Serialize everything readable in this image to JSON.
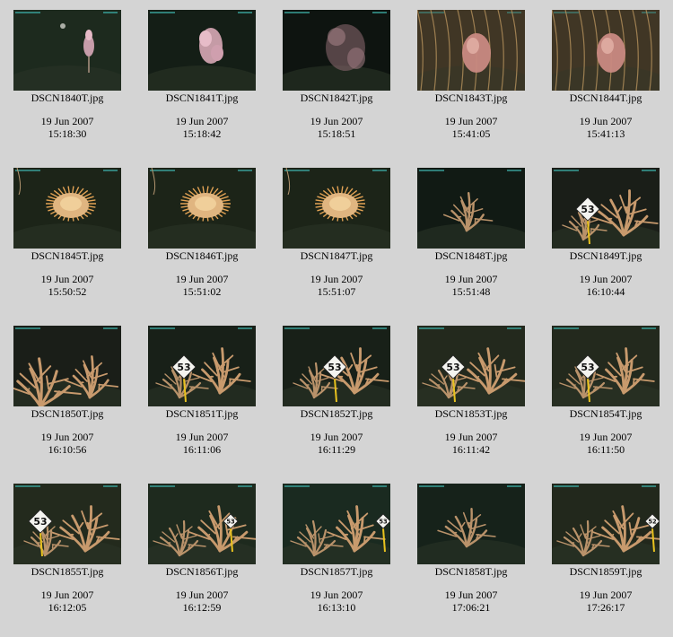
{
  "gallery": {
    "items": [
      {
        "filename": "DSCN1840T.jpg",
        "date": "19 Jun 2007",
        "time": "15:18:30",
        "thumb_icon": "pink-coral-small-photo",
        "bg": "#1d2a1e"
      },
      {
        "filename": "DSCN1841T.jpg",
        "date": "19 Jun 2007",
        "time": "15:18:42",
        "thumb_icon": "pink-coral-photo",
        "bg": "#141e16"
      },
      {
        "filename": "DSCN1842T.jpg",
        "date": "19 Jun 2007",
        "time": "15:18:51",
        "thumb_icon": "pink-coral-dark-photo",
        "bg": "#0e1410"
      },
      {
        "filename": "DSCN1843T.jpg",
        "date": "19 Jun 2007",
        "time": "15:41:05",
        "thumb_icon": "anemone-photo",
        "bg": "#3a3222"
      },
      {
        "filename": "DSCN1844T.jpg",
        "date": "19 Jun 2007",
        "time": "15:41:13",
        "thumb_icon": "anemone-photo",
        "bg": "#3a3222"
      },
      {
        "filename": "DSCN1845T.jpg",
        "date": "19 Jun 2007",
        "time": "15:50:52",
        "thumb_icon": "orange-anemone-photo",
        "bg": "#1c2418"
      },
      {
        "filename": "DSCN1846T.jpg",
        "date": "19 Jun 2007",
        "time": "15:51:02",
        "thumb_icon": "orange-anemone-photo",
        "bg": "#1c2418"
      },
      {
        "filename": "DSCN1847T.jpg",
        "date": "19 Jun 2007",
        "time": "15:51:07",
        "thumb_icon": "orange-anemone-photo",
        "bg": "#1c2418"
      },
      {
        "filename": "DSCN1848T.jpg",
        "date": "19 Jun 2007",
        "time": "15:51:48",
        "thumb_icon": "sea-fan-photo",
        "bg": "#111a14"
      },
      {
        "filename": "DSCN1849T.jpg",
        "date": "19 Jun 2007",
        "time": "16:10:44",
        "thumb_icon": "coral-marker-photo",
        "bg": "#1a1e18",
        "marker": "53"
      },
      {
        "filename": "DSCN1850T.jpg",
        "date": "19 Jun 2007",
        "time": "16:10:56",
        "thumb_icon": "coral-colony-photo",
        "bg": "#1a1e18"
      },
      {
        "filename": "DSCN1851T.jpg",
        "date": "19 Jun 2007",
        "time": "16:11:06",
        "thumb_icon": "coral-marker-photo",
        "bg": "#182018",
        "marker": "53"
      },
      {
        "filename": "DSCN1852T.jpg",
        "date": "19 Jun 2007",
        "time": "16:11:29",
        "thumb_icon": "coral-marker-photo",
        "bg": "#182018",
        "marker": "53"
      },
      {
        "filename": "DSCN1853T.jpg",
        "date": "19 Jun 2007",
        "time": "16:11:42",
        "thumb_icon": "coral-marker-photo",
        "bg": "#23291d",
        "marker": "53"
      },
      {
        "filename": "DSCN1854T.jpg",
        "date": "19 Jun 2007",
        "time": "16:11:50",
        "thumb_icon": "coral-marker-photo",
        "bg": "#23291d",
        "marker": "53"
      },
      {
        "filename": "DSCN1855T.jpg",
        "date": "19 Jun 2007",
        "time": "16:12:05",
        "thumb_icon": "coral-marker-photo",
        "bg": "#232a1d",
        "marker": "53"
      },
      {
        "filename": "DSCN1856T.jpg",
        "date": "19 Jun 2007",
        "time": "16:12:59",
        "thumb_icon": "coral-marker-photo",
        "bg": "#1e2a1e",
        "marker": "53"
      },
      {
        "filename": "DSCN1857T.jpg",
        "date": "19 Jun 2007",
        "time": "16:13:10",
        "thumb_icon": "coral-marker-photo",
        "bg": "#1a2a20",
        "marker": "53"
      },
      {
        "filename": "DSCN1858T.jpg",
        "date": "19 Jun 2007",
        "time": "17:06:21",
        "thumb_icon": "sea-fan-photo",
        "bg": "#16221a"
      },
      {
        "filename": "DSCN1859T.jpg",
        "date": "19 Jun 2007",
        "time": "17:26:17",
        "thumb_icon": "coral-marker-photo",
        "bg": "#22281c",
        "marker": "52"
      }
    ]
  }
}
